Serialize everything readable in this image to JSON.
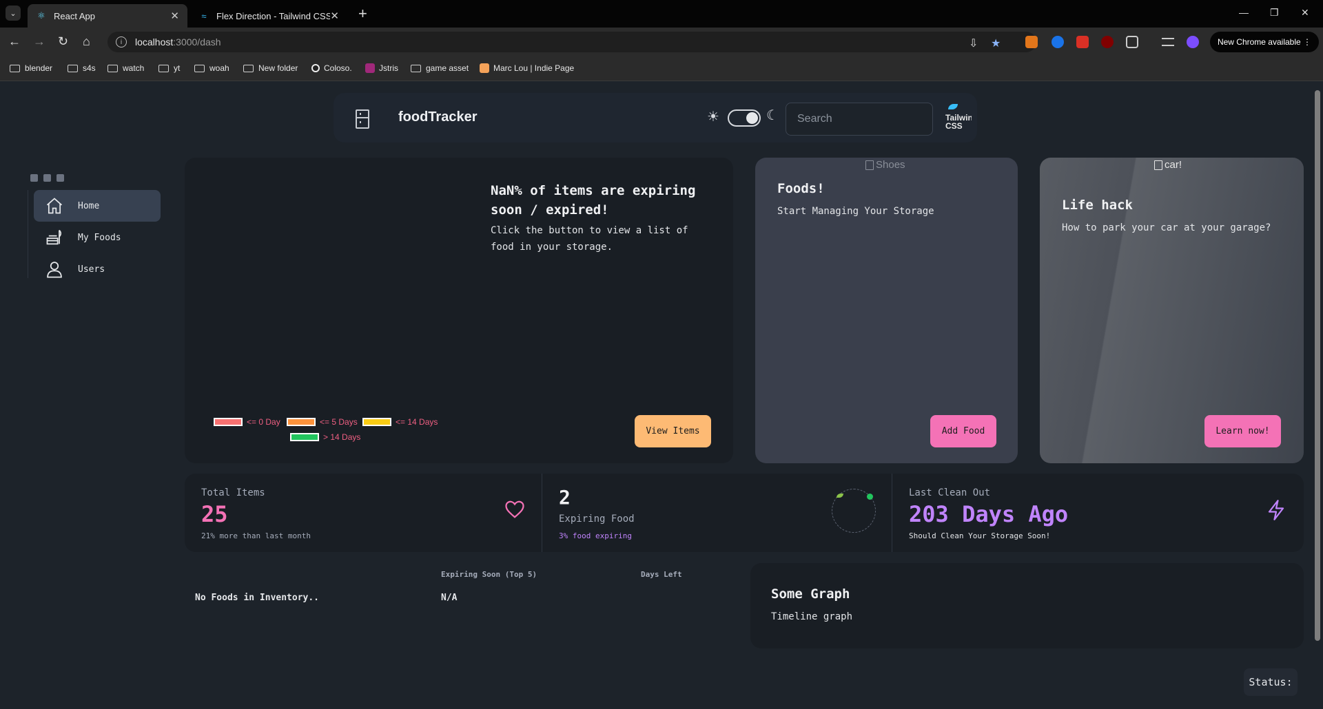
{
  "browser": {
    "tabs": [
      {
        "title": "React App",
        "icon": "react-icon",
        "active": true
      },
      {
        "title": "Flex Direction - Tailwind CSS",
        "icon": "tailwind-icon",
        "active": false
      }
    ],
    "url_host": "localhost",
    "url_path": ":3000/dash",
    "new_chrome_label": "New Chrome available",
    "bookmarks": [
      "blender",
      "s4s",
      "watch",
      "yt",
      "woah",
      "New folder",
      "Coloso.",
      "Jstris",
      "game asset",
      "Marc Lou | Indie Page"
    ]
  },
  "navbar": {
    "brand": "foodTracker",
    "search_placeholder": "Search",
    "avatar_label": "Tailwind CSS"
  },
  "sidebar": {
    "items": [
      {
        "label": "Home",
        "icon": "home-icon",
        "active": true
      },
      {
        "label": "My Foods",
        "icon": "food-icon",
        "active": false
      },
      {
        "label": "Users",
        "icon": "user-icon",
        "active": false
      }
    ]
  },
  "hero": {
    "title": "NaN% of items are expiring soon / expired!",
    "text": "Click the button to view a list of food in your storage.",
    "button": "View Items",
    "legend": [
      {
        "label": "<= 0 Day",
        "color": "#f87171"
      },
      {
        "label": "<= 5 Days",
        "color": "#fb923c"
      },
      {
        "label": "<= 14 Days",
        "color": "#facc15"
      },
      {
        "label": "> 14 Days",
        "color": "#22c55e"
      }
    ]
  },
  "foods_card": {
    "img_alt": "Shoes",
    "title": "Foods!",
    "text": "Start Managing Your Storage",
    "button": "Add Food"
  },
  "lifehack_card": {
    "img_alt": "car!",
    "title": "Life hack",
    "text": "How to park your car at your garage?",
    "button": "Learn now!"
  },
  "stats": {
    "total": {
      "title": "Total Items",
      "value": "25",
      "desc": "21% more than last month",
      "color": "#f472b6"
    },
    "expiring": {
      "value": "2",
      "title": "Expiring Food",
      "desc": "3% food expiring",
      "color": "#c084fc"
    },
    "clean": {
      "title": "Last Clean Out",
      "value": "203 Days Ago",
      "desc": "Should Clean Your Storage Soon!",
      "color": "#c084fc"
    }
  },
  "table": {
    "headers": [
      "Expiring Soon (Top 5)",
      "Days Left"
    ],
    "row": [
      "No Foods in Inventory..",
      "N/A"
    ]
  },
  "graph_card": {
    "title": "Some Graph",
    "text": "Timeline graph"
  },
  "status_label": "Status:"
}
